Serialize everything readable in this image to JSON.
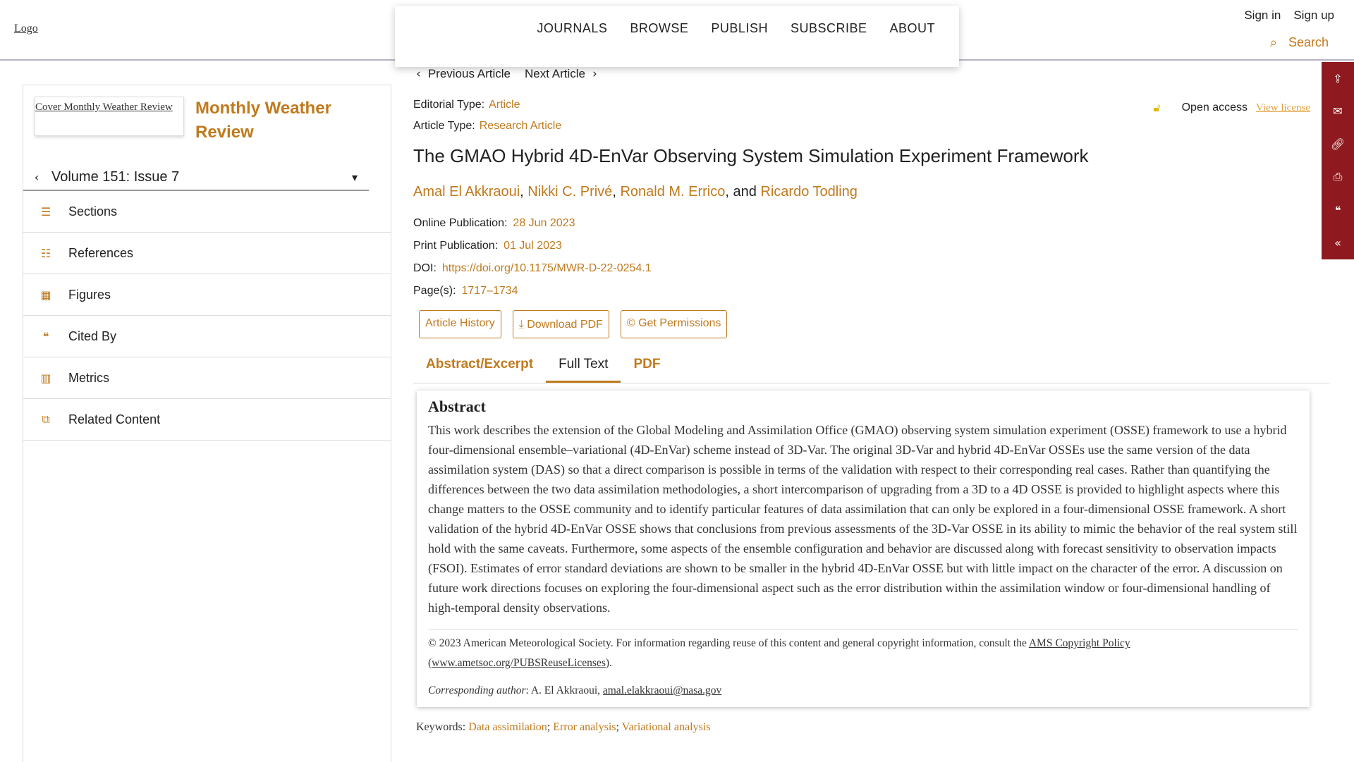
{
  "header": {
    "logo_alt": "Logo",
    "nav": [
      "JOURNALS",
      "BROWSE",
      "PUBLISH",
      "SUBSCRIBE",
      "ABOUT"
    ],
    "sign_in": "Sign in",
    "sign_up": "Sign up",
    "search_label": "Search"
  },
  "article_nav": {
    "prev": "Previous Article",
    "next": "Next Article"
  },
  "sidebar": {
    "cover_alt": "Cover Monthly Weather Review",
    "journal_title": "Monthly Weather Review",
    "volume": "Volume 151: Issue 7",
    "items": [
      "Sections",
      "References",
      "Figures",
      "Cited By",
      "Metrics",
      "Related Content"
    ]
  },
  "meta": {
    "editorial_type_label": "Editorial Type:",
    "editorial_type": "Article",
    "article_type_label": "Article Type:",
    "article_type": "Research Article",
    "open_access": "Open access",
    "view_license": "View license"
  },
  "article": {
    "title": "The GMAO Hybrid 4D-EnVar Observing System Simulation Experiment Framework",
    "authors": [
      "Amal El Akkraoui",
      "Nikki C. Privé",
      "Ronald M. Errico",
      "Ricardo Todling"
    ],
    "sep1": ", ",
    "sep2": ", ",
    "sep3": ", and ",
    "online_label": "Online Publication:",
    "online_date": "28 Jun 2023",
    "print_label": "Print Publication:",
    "print_date": "01 Jul 2023",
    "doi_label": "DOI:",
    "doi": "https://doi.org/10.1175/MWR-D-22-0254.1",
    "pages_label": "Page(s):",
    "pages": "1717–1734"
  },
  "buttons": {
    "history": "Article History",
    "pdf": "Download PDF",
    "permissions": "© Get Permissions"
  },
  "tabs": [
    "Abstract/Excerpt",
    "Full Text",
    "PDF"
  ],
  "abstract": {
    "heading": "Abstract",
    "text": "This work describes the extension of the Global Modeling and Assimilation Office (GMAO) observing system simulation experiment (OSSE) framework to use a hybrid four-dimensional ensemble–variational (4D-EnVar) scheme instead of 3D-Var. The original 3D-Var and hybrid 4D-EnVar OSSEs use the same version of the data assimilation system (DAS) so that a direct comparison is possible in terms of the validation with respect to their corresponding real cases. Rather than quantifying the differences between the two data assimilation methodologies, a short intercomparison of upgrading from a 3D to a 4D OSSE is provided to highlight aspects where this change matters to the OSSE community and to identify particular features of data assimilation that can only be explored in a four-dimensional OSSE framework. A short validation of the hybrid 4D-EnVar OSSE shows that conclusions from previous assessments of the 3D-Var OSSE in its ability to mimic the behavior of the real system still hold with the same caveats. Furthermore, some aspects of the ensemble configuration and behavior are discussed along with forecast sensitivity to observation impacts (FSOI). Estimates of error standard deviations are shown to be smaller in the hybrid 4D-EnVar OSSE but with little impact on the character of the error. A discussion on future work directions focuses on exploring the four-dimensional aspect such as the error distribution within the assimilation window or four-dimensional handling of high-temporal density observations.",
    "copyright_pre": "© 2023 American Meteorological Society. For information regarding reuse of this content and general copyright information, consult the ",
    "copyright_link": "AMS Copyright Policy",
    "copyright_mid": " (",
    "copyright_url": "www.ametsoc.org/PUBSReuseLicenses",
    "copyright_post": ").",
    "corr_label": "Corresponding author",
    "corr_name": ": A. El Akkraoui, ",
    "corr_email": "amal.elakkraoui@nasa.gov"
  },
  "keywords": {
    "label": "Keywords:",
    "items": [
      "Data assimilation",
      "Error analysis",
      "Variational analysis"
    ]
  },
  "colors": {
    "accent": "#c07a1e",
    "share_bar": "#8e1a1f"
  },
  "icons": {
    "share": [
      "share-icon",
      "mail-icon",
      "link-icon",
      "print-icon",
      "cite-icon",
      "collapse-icon"
    ]
  }
}
